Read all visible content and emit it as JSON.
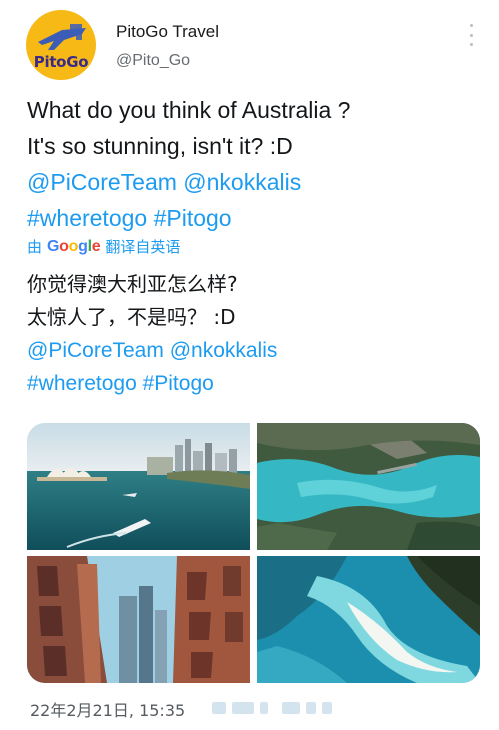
{
  "account": {
    "display_name": "PitoGo Travel",
    "handle": "@Pito_Go",
    "avatar_text": "PitoGo",
    "avatar_color": "#f6b916"
  },
  "tweet": {
    "line1": "What do you think of Australia ?",
    "line2": "It's so stunning, isn't it? :D",
    "mentions": "@PiCoreTeam @nkokkalis",
    "hashtags": "#wheretogo #Pitogo"
  },
  "translation": {
    "prefix": "由",
    "google_letters": [
      "G",
      "o",
      "o",
      "g",
      "l",
      "e"
    ],
    "suffix": "翻译自英语",
    "line1": "你觉得澳大利亚怎么样?",
    "line2": "太惊人了，不是吗？ :D",
    "mentions": "@PiCoreTeam @nkokkalis",
    "hashtags": "#wheretogo #Pitogo"
  },
  "media": {
    "photos": [
      "sydney-harbour",
      "sydney-aerial",
      "city-street",
      "whitehaven-beach"
    ]
  },
  "meta": {
    "timestamp": "22年2月21日, 15:35"
  },
  "colors": {
    "link": "#1d9bf0",
    "text": "#14171a",
    "secondary": "#666c72"
  },
  "icons": [
    "more-vertical-icon",
    "plane-icon"
  ]
}
